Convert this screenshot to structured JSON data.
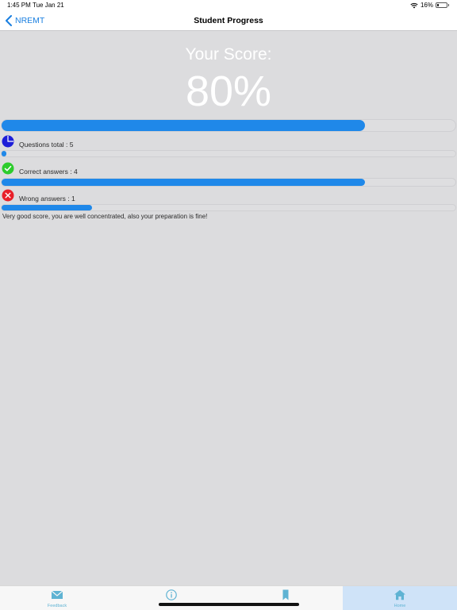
{
  "status_bar": {
    "time": "1:45 PM",
    "date": "Tue Jan 21",
    "battery": "16%",
    "battery_level": 0.16
  },
  "nav": {
    "back_label": "NREMT",
    "title": "Student Progress"
  },
  "score": {
    "label": "Your Score:",
    "value": "80%",
    "fraction": 0.8
  },
  "stats": [
    {
      "label": "Questions total : 5",
      "icon": "pie-chart-icon",
      "progress": 0.01
    },
    {
      "label": "Correct answers : 4",
      "icon": "check-circle-icon",
      "progress": 0.8
    },
    {
      "label": "Wrong answers : 1",
      "icon": "x-circle-icon",
      "progress": 0.2
    }
  ],
  "comment": "Very good score, you are well concentrated, also your preparation is fine!",
  "tabs": [
    {
      "label": "Feedback",
      "icon": "envelope-icon"
    },
    {
      "label": "",
      "icon": "info-icon"
    },
    {
      "label": "",
      "icon": "bookmark-icon"
    },
    {
      "label": "Home",
      "icon": "home-icon",
      "active": true
    }
  ],
  "colors": {
    "accent": "#1a7fe0",
    "progress": "#1f88e9",
    "background": "#dcdcde",
    "correct": "#2dcc2d",
    "wrong": "#e8202a",
    "total": "#1d1ed8",
    "tab_active": "#cfe3f8",
    "tab_icon": "#5fb3d3"
  }
}
